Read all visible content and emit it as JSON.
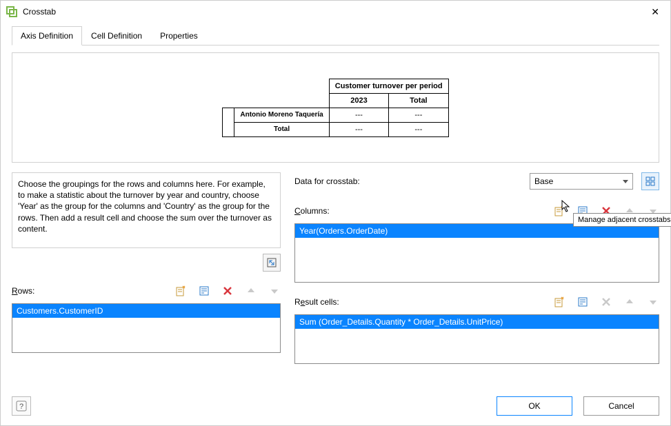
{
  "window": {
    "title": "Crosstab"
  },
  "tabs": {
    "items": [
      "Axis Definition",
      "Cell Definition",
      "Properties"
    ],
    "active": 0
  },
  "preview": {
    "title": "Customer turnover per period",
    "col_headers": [
      "2023",
      "Total"
    ],
    "row_headers": [
      "Antonio Moreno Taquería",
      "Total"
    ],
    "cells": [
      [
        "---",
        "---"
      ],
      [
        "---",
        "---"
      ]
    ]
  },
  "description": "Choose the groupings for the rows and columns here. For example, to make a statistic about the turnover by year and country, choose 'Year' as the group for the columns and 'Country' as the group for the rows. Then add a result cell and choose the sum over the turnover as content.",
  "rows": {
    "label": "Rows:",
    "items": [
      "Customers.CustomerID"
    ]
  },
  "data": {
    "label": "Data for crosstab:",
    "selected": "Base"
  },
  "columns": {
    "label": "Columns:",
    "items": [
      "Year(Orders.OrderDate)"
    ]
  },
  "result": {
    "label": "Result cells:",
    "items": [
      "Sum (Order_Details.Quantity * Order_Details.UnitPrice)"
    ]
  },
  "tooltip": "Manage adjacent crosstabs",
  "buttons": {
    "ok": "OK",
    "cancel": "Cancel"
  }
}
